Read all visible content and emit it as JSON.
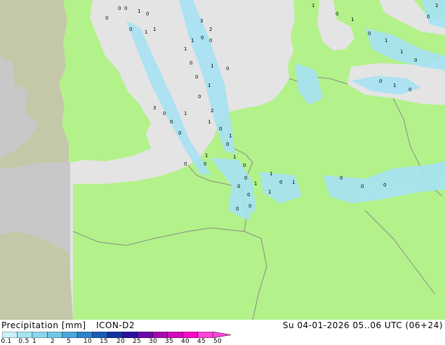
{
  "header": {
    "title": "Precipitation [mm]",
    "model": "ICON-D2",
    "valid": "Su 04-01-2026 05..06 UTC (06+24)"
  },
  "legend": {
    "ticks": [
      "0.1",
      "0.5",
      "1",
      "2",
      "5",
      "10",
      "15",
      "20",
      "25",
      "30",
      "35",
      "40",
      "45",
      "50"
    ],
    "colors": [
      "#c8f0f8",
      "#a6e4f4",
      "#8cd8ee",
      "#70c8e6",
      "#4aa6da",
      "#2c84cc",
      "#1a5cb6",
      "#1234a2",
      "#2a10a0",
      "#6a0aa8",
      "#a408b0",
      "#d408bc",
      "#f808c8",
      "#fc44d8"
    ]
  },
  "map": {
    "colors": {
      "land": "#b3f28a",
      "sea": "#e4e4e4",
      "outside": "#c8c8c8",
      "outside_land": "#c4c8a8",
      "border": "#8a8a8a",
      "rain": "#a6e2f4"
    },
    "labels": [
      {
        "t": "0"
      },
      {
        "t": "0"
      },
      {
        "t": "1"
      },
      {
        "t": "0"
      },
      {
        "t": "0"
      },
      {
        "t": "1"
      },
      {
        "t": "0"
      },
      {
        "t": "1"
      },
      {
        "t": "3"
      },
      {
        "t": "2"
      },
      {
        "t": "0"
      },
      {
        "t": "1"
      },
      {
        "t": "1"
      },
      {
        "t": "0"
      },
      {
        "t": "0"
      },
      {
        "t": "1"
      },
      {
        "t": "0"
      },
      {
        "t": "0"
      },
      {
        "t": "1"
      },
      {
        "t": "0"
      },
      {
        "t": "2"
      },
      {
        "t": "1"
      },
      {
        "t": "0"
      },
      {
        "t": "1"
      },
      {
        "t": "0"
      },
      {
        "t": "0"
      },
      {
        "t": "1"
      },
      {
        "t": "0"
      },
      {
        "t": "1"
      },
      {
        "t": "0"
      },
      {
        "t": "0"
      },
      {
        "t": "1"
      },
      {
        "t": "0"
      },
      {
        "t": "0"
      },
      {
        "t": "0"
      },
      {
        "t": "1"
      },
      {
        "t": "1"
      },
      {
        "t": "0"
      },
      {
        "t": "1"
      },
      {
        "t": "1"
      },
      {
        "t": "0"
      },
      {
        "t": "0"
      },
      {
        "t": "0"
      },
      {
        "t": "1"
      },
      {
        "t": "0"
      },
      {
        "t": "1"
      },
      {
        "t": "0"
      },
      {
        "t": "1"
      },
      {
        "t": "1"
      },
      {
        "t": "0"
      },
      {
        "t": "0"
      },
      {
        "t": "1"
      },
      {
        "t": "0"
      },
      {
        "t": "0"
      },
      {
        "t": "0"
      },
      {
        "t": "0"
      },
      {
        "t": "3"
      },
      {
        "t": "0"
      },
      {
        "t": "1"
      },
      {
        "t": "0"
      }
    ]
  }
}
